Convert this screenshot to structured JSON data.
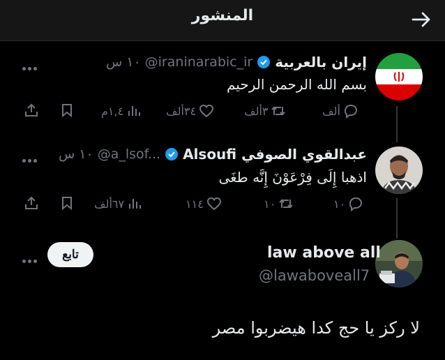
{
  "header": {
    "title": "المنشور"
  },
  "tweets": [
    {
      "name": "إيران بالعربية",
      "handle": "@iraninarabic_ir",
      "time": "١٠ س",
      "text": "بسم الله الرحمن الرحيم",
      "stats": {
        "replies": "ألف",
        "retweets": "٣ألف",
        "likes": "٣٤ألف",
        "views": "١,٤م"
      }
    },
    {
      "name": "عبدالقوي الصوفي Alsoufi",
      "handle": "@a_lsof...",
      "time": "١٠ س",
      "text": "اذهبا إِلَى فِرْعَوْنَ إِنَّه طغَى",
      "stats": {
        "replies": "١٠",
        "retweets": "١٠",
        "likes": "١١٤",
        "views": "٦٧ألف"
      }
    }
  ],
  "main": {
    "name": "law above all",
    "handle": "@lawaboveall7",
    "follow_label": "تابع",
    "text": "لا ركز يا حج كدا هيضربوا مصر"
  },
  "colors": {
    "background": "#000000",
    "text": "#e7e9ea",
    "muted": "#71767b",
    "verified": "#1d9bf0"
  },
  "icons": [
    "back-arrow-icon",
    "verified-icon",
    "more-icon",
    "reply-icon",
    "retweet-icon",
    "like-icon",
    "views-icon",
    "bookmark-icon",
    "share-icon"
  ]
}
